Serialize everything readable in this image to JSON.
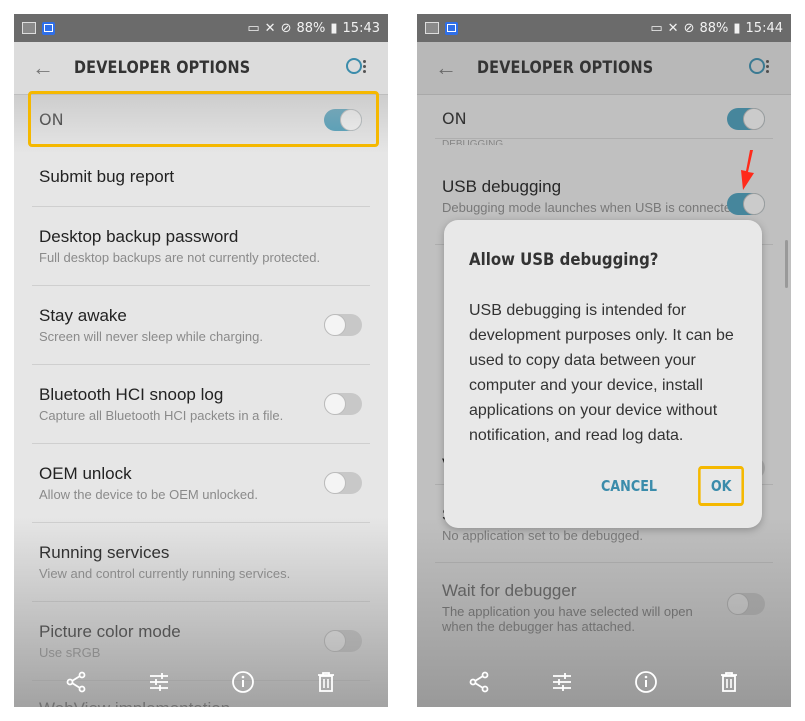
{
  "left_screen": {
    "status": {
      "battery": "88%",
      "time": "15:43",
      "icons": [
        "gallery-icon",
        "app-icon",
        "cast-icon",
        "mute-icon",
        "block-icon",
        "battery-icon"
      ]
    },
    "appbar": {
      "title": "DEVELOPER OPTIONS",
      "back_icon": "back-arrow-icon",
      "search_icon": "search-icon",
      "more_icon": "more-vert-icon"
    },
    "master": {
      "label": "ON",
      "on": true,
      "highlighted": true
    },
    "rows": [
      {
        "title": "Submit bug report",
        "subtitle": ""
      },
      {
        "title": "Desktop backup password",
        "subtitle": "Full desktop backups are not currently protected."
      },
      {
        "title": "Stay awake",
        "subtitle": "Screen will never sleep while charging.",
        "toggle": false
      },
      {
        "title": "Bluetooth HCI snoop log",
        "subtitle": "Capture all Bluetooth HCI packets in a file.",
        "toggle": false
      },
      {
        "title": "OEM unlock",
        "subtitle": "Allow the device to be OEM unlocked.",
        "toggle": false
      },
      {
        "title": "Running services",
        "subtitle": "View and control currently running services."
      },
      {
        "title": "Picture color mode",
        "subtitle": "Use sRGB",
        "toggle": false
      },
      {
        "title": "WebView implementation",
        "subtitle": ""
      }
    ],
    "bottom_icons": [
      "share-icon",
      "settings-sliders-icon",
      "info-icon",
      "delete-icon"
    ]
  },
  "right_screen": {
    "status": {
      "battery": "88%",
      "time": "15:44"
    },
    "appbar": {
      "title": "DEVELOPER OPTIONS"
    },
    "master": {
      "label": "ON",
      "on": true
    },
    "section_header": "DEBUGGING",
    "rows": [
      {
        "title": "USB debugging",
        "subtitle": "Debugging mode launches when USB is connected.",
        "toggle": true
      },
      {
        "title": "View attribute inspection",
        "subtitle": "",
        "toggle": false
      },
      {
        "title": "Select app to be debugged",
        "subtitle": "No application set to be debugged."
      },
      {
        "title": "Wait for debugger",
        "subtitle": "The application you have selected will open when the debugger has attached.",
        "toggle": false
      }
    ],
    "dialog": {
      "title": "Allow USB debugging?",
      "body": "USB debugging is intended for development purposes only. It can be used to copy data between your computer and your device, install applications on your device without notification, and read log data.",
      "cancel_label": "CANCEL",
      "ok_label": "OK",
      "ok_highlighted": true
    },
    "annotation": "red-arrow pointing to USB debugging toggle"
  },
  "colors": {
    "accent": "#3b8cab",
    "toggle_on": "#4a9cb8",
    "highlight": "#f5b800",
    "arrow": "#ff2a1a"
  }
}
